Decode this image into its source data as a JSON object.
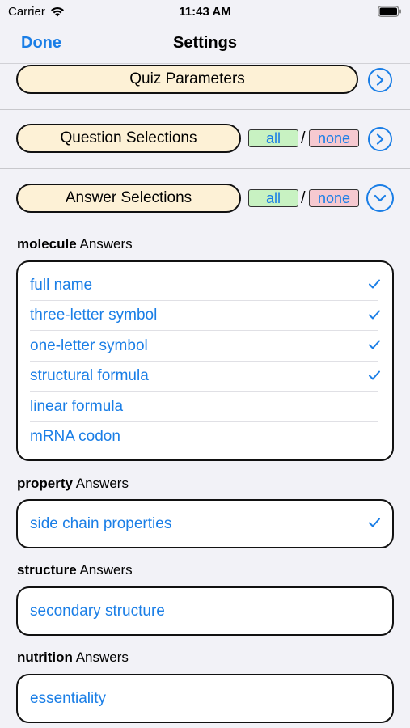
{
  "status_bar": {
    "carrier": "Carrier",
    "time": "11:43 AM"
  },
  "nav": {
    "done_label": "Done",
    "title": "Settings"
  },
  "sections": {
    "quiz_parameters": {
      "label": "Quiz Parameters"
    },
    "question_selections": {
      "label": "Question Selections",
      "all_label": "all",
      "none_label": "none",
      "slash": "/"
    },
    "answer_selections": {
      "label": "Answer Selections",
      "all_label": "all",
      "none_label": "none",
      "slash": "/"
    }
  },
  "groups": {
    "molecule": {
      "name": "molecule",
      "suffix": " Answers",
      "items": [
        {
          "label": "full name",
          "checked": true
        },
        {
          "label": "three-letter symbol",
          "checked": true
        },
        {
          "label": "one-letter symbol",
          "checked": true
        },
        {
          "label": "structural formula",
          "checked": true
        },
        {
          "label": "linear formula",
          "checked": false
        },
        {
          "label": "mRNA codon",
          "checked": false
        }
      ]
    },
    "property": {
      "name": "property",
      "suffix": " Answers",
      "items": [
        {
          "label": "side chain properties",
          "checked": true
        }
      ]
    },
    "structure": {
      "name": "structure",
      "suffix": " Answers",
      "items": [
        {
          "label": "secondary structure",
          "checked": false
        }
      ]
    },
    "nutrition": {
      "name": "nutrition",
      "suffix": " Answers",
      "items": [
        {
          "label": "essentiality",
          "checked": false
        }
      ]
    }
  },
  "colors": {
    "accent": "#1a7ee6",
    "pill_bg": "#fdf1d6",
    "all_bg": "#c8f2c2",
    "none_bg": "#f6c9d0",
    "background": "#f2f2f7"
  }
}
